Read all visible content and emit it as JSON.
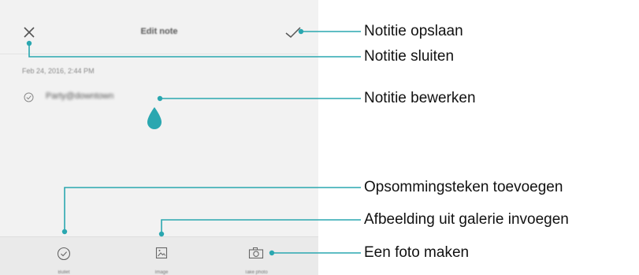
{
  "app": {
    "title": "Edit note",
    "date": "Feb 24, 2016, 2:44 PM",
    "checklist_item": "Party@downtown"
  },
  "toolbar": {
    "bullet_label": "Bullet",
    "image_label": "Image",
    "photo_label": "Take photo"
  },
  "callouts": {
    "save": "Notitie opslaan",
    "close": "Notitie sluiten",
    "edit": "Notitie bewerken",
    "bullet": "Opsommingsteken toevoegen",
    "gallery": "Afbeelding uit galerie invoegen",
    "photo": "Een foto maken"
  },
  "colors": {
    "accent": "#2aa7b0",
    "background": "#f2f2f2"
  }
}
